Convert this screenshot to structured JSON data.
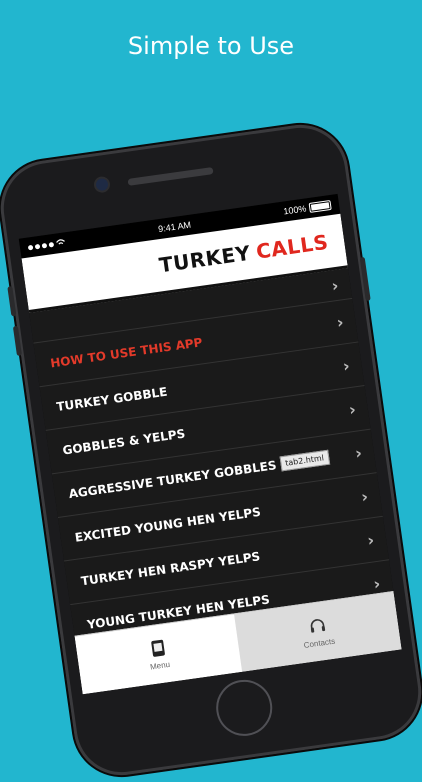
{
  "headline": "Simple to Use",
  "status_bar": {
    "time": "9:41 AM",
    "battery": "100%"
  },
  "banner": {
    "title_part1": "TURKEY",
    "title_part2": "CALLS",
    "title_part2_color": "#e0271e"
  },
  "menu": {
    "items": [
      {
        "label": "",
        "highlight": false
      },
      {
        "label": "HOW TO USE THIS APP",
        "highlight": true
      },
      {
        "label": "TURKEY GOBBLE",
        "highlight": false
      },
      {
        "label": "GOBBLES & YELPS",
        "highlight": false
      },
      {
        "label": "AGGRESSIVE TURKEY GOBBLES",
        "highlight": false,
        "tooltip": "tab2.html"
      },
      {
        "label": "EXCITED YOUNG HEN YELPS",
        "highlight": false
      },
      {
        "label": "TURKEY HEN RASPY YELPS",
        "highlight": false
      },
      {
        "label": "YOUNG TURKEY HEN YELPS",
        "highlight": false
      }
    ]
  },
  "tabs": [
    {
      "label": "Menu",
      "icon": "phone-menu-icon",
      "active": true
    },
    {
      "label": "Contacts",
      "icon": "headset-icon",
      "active": false
    }
  ],
  "colors": {
    "background": "#22b6cf",
    "highlight": "#e33a2a"
  }
}
